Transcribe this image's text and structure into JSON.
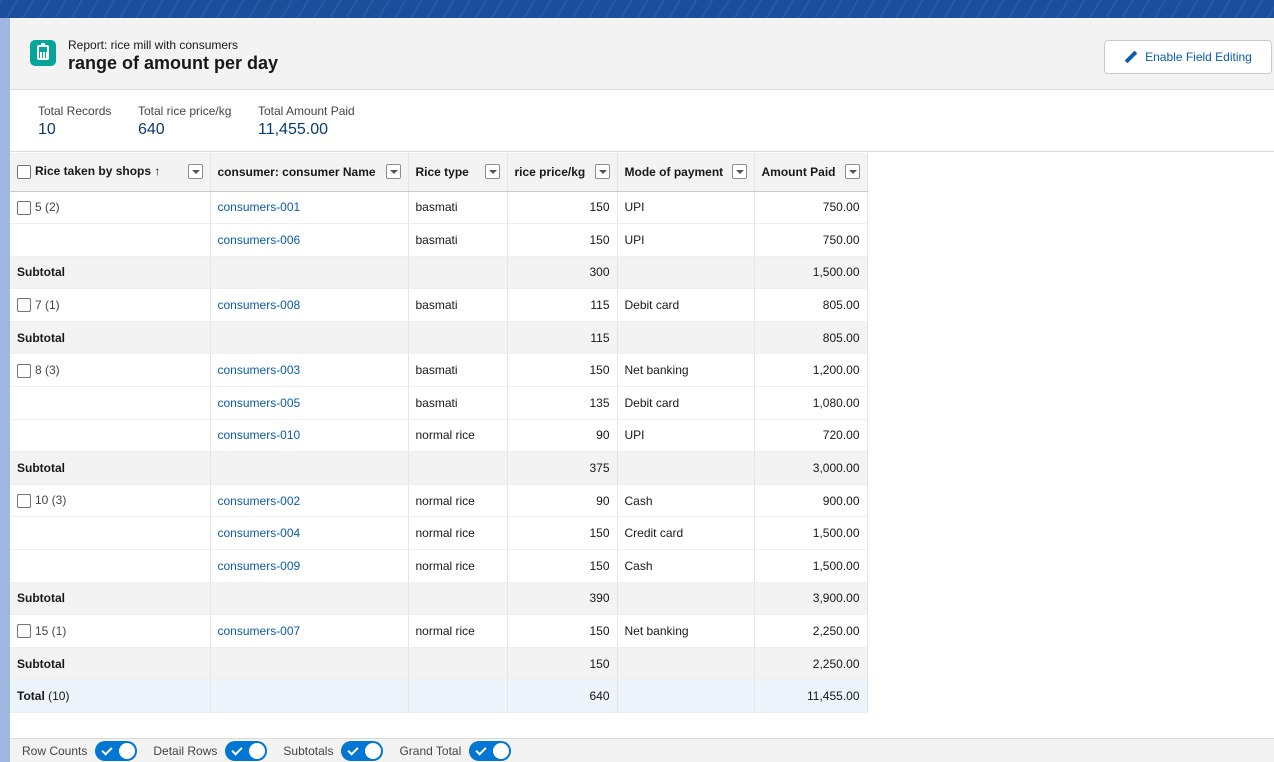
{
  "header": {
    "subtitle": "Report: rice mill with consumers",
    "title": "range of amount per day",
    "edit_button": "Enable Field Editing"
  },
  "summary": [
    {
      "label": "Total Records",
      "value": "10"
    },
    {
      "label": "Total rice price/kg",
      "value": "640"
    },
    {
      "label": "Total Amount Paid",
      "value": "11,455.00"
    }
  ],
  "table": {
    "columns": [
      "Rice taken by shops",
      "consumer: consumer Name",
      "Rice type",
      "rice price/kg",
      "Mode of payment",
      "Amount Paid"
    ],
    "sort_indicator": "↑",
    "groups": [
      {
        "label": "5 (2)",
        "rows": [
          {
            "name": "consumers-001",
            "type": "basmati",
            "price": "150",
            "mode": "UPI",
            "amount": "750.00"
          },
          {
            "name": "consumers-006",
            "type": "basmati",
            "price": "150",
            "mode": "UPI",
            "amount": "750.00"
          }
        ],
        "subtotal": {
          "label": "Subtotal",
          "price": "300",
          "amount": "1,500.00"
        }
      },
      {
        "label": "7 (1)",
        "rows": [
          {
            "name": "consumers-008",
            "type": "basmati",
            "price": "115",
            "mode": "Debit card",
            "amount": "805.00"
          }
        ],
        "subtotal": {
          "label": "Subtotal",
          "price": "115",
          "amount": "805.00"
        }
      },
      {
        "label": "8 (3)",
        "rows": [
          {
            "name": "consumers-003",
            "type": "basmati",
            "price": "150",
            "mode": "Net banking",
            "amount": "1,200.00"
          },
          {
            "name": "consumers-005",
            "type": "basmati",
            "price": "135",
            "mode": "Debit card",
            "amount": "1,080.00"
          },
          {
            "name": "consumers-010",
            "type": "normal rice",
            "price": "90",
            "mode": "UPI",
            "amount": "720.00"
          }
        ],
        "subtotal": {
          "label": "Subtotal",
          "price": "375",
          "amount": "3,000.00"
        }
      },
      {
        "label": "10 (3)",
        "rows": [
          {
            "name": "consumers-002",
            "type": "normal rice",
            "price": "90",
            "mode": "Cash",
            "amount": "900.00"
          },
          {
            "name": "consumers-004",
            "type": "normal rice",
            "price": "150",
            "mode": "Credit card",
            "amount": "1,500.00"
          },
          {
            "name": "consumers-009",
            "type": "normal rice",
            "price": "150",
            "mode": "Cash",
            "amount": "1,500.00"
          }
        ],
        "subtotal": {
          "label": "Subtotal",
          "price": "390",
          "amount": "3,900.00"
        }
      },
      {
        "label": "15 (1)",
        "rows": [
          {
            "name": "consumers-007",
            "type": "normal rice",
            "price": "150",
            "mode": "Net banking",
            "amount": "2,250.00"
          }
        ],
        "subtotal": {
          "label": "Subtotal",
          "price": "150",
          "amount": "2,250.00"
        }
      }
    ],
    "total": {
      "label": "Total",
      "count": "(10)",
      "price": "640",
      "amount": "11,455.00"
    }
  },
  "footer": {
    "toggles": [
      {
        "label": "Row Counts",
        "on": true
      },
      {
        "label": "Detail Rows",
        "on": true
      },
      {
        "label": "Subtotals",
        "on": true
      },
      {
        "label": "Grand Total",
        "on": true
      }
    ]
  },
  "colors": {
    "accent": "#0176d3",
    "link": "#0b5cab",
    "icon_bg": "#06a59a"
  }
}
